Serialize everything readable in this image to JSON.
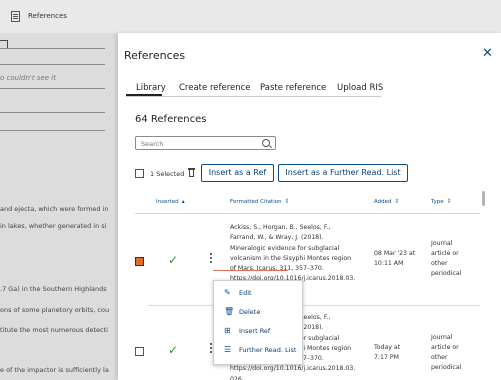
{
  "topbar": {
    "title": "References"
  },
  "background": {
    "field_hint": "o couldn't see it",
    "lines": [
      "and ejecta, which were formed in",
      " in lakes, whether generated in si",
      ".7 Ga) in the Southern Highlands",
      "ons of some planetory orbits, cou",
      "titute the most numerous detecti",
      "e of the impactor is sufficiently la"
    ]
  },
  "panel": {
    "title": "References",
    "tabs": [
      "Library",
      "Create reference",
      "Paste reference",
      "Upload RIS"
    ],
    "active_tab": "Library",
    "count_label": "64 References",
    "search": {
      "placeholder": "Search",
      "value": ""
    },
    "selected_label": "1 Selected",
    "insert_ref_label": "Insert as a Ref",
    "insert_further_label": "Insert as a Further Read. List",
    "columns": {
      "inserted": "Inserted",
      "citation": "Formatted Citation",
      "added": "Added",
      "type": "Type"
    },
    "rows": [
      {
        "checked": true,
        "inserted": true,
        "citation": [
          "Ackiss, S., Horgan, B., Seelos, F.,",
          "Farrand, W., & Wray, J. (2018).",
          "Mineralogic evidence for subglacial",
          "volcanism in the Sisyphi Montes region",
          "of Mars. Icarus, 311, 357–370.",
          "https://doi.org/10.1016/j.icarus.2018.03."
        ],
        "added": [
          "08 Mar '23 at",
          "10:11 AM"
        ],
        "type": [
          "Journal",
          "article or",
          "other",
          "periodical"
        ]
      },
      {
        "checked": false,
        "inserted": true,
        "citation": [
          "Ackiss, S., Horgan, B., Seelos, F.,",
          "Farrand, W., & Wray, J. (2018).",
          "Mineralogic evidence for subglacial",
          "volcanism in the Sisyphi Montes region",
          "of Mars. Icarus, 311, 357–370.",
          "https://doi.org/10.1016/j.icarus.2018.03.",
          "026"
        ],
        "added": [
          "Today at",
          "7:17 PM"
        ],
        "type": [
          "Journal",
          "article or",
          "other",
          "periodical"
        ]
      }
    ],
    "menu": [
      {
        "label": "Edit",
        "icon": "pencil-icon"
      },
      {
        "label": "Delete",
        "icon": "trash-icon"
      },
      {
        "label": "Insert Ref",
        "icon": "insert-icon"
      },
      {
        "label": "Further Read. List",
        "icon": "list-icon"
      }
    ]
  },
  "colors": {
    "accent": "#0b4f8a",
    "check": "#1a9a3a",
    "selected_checkbox": "#e36a2d"
  }
}
